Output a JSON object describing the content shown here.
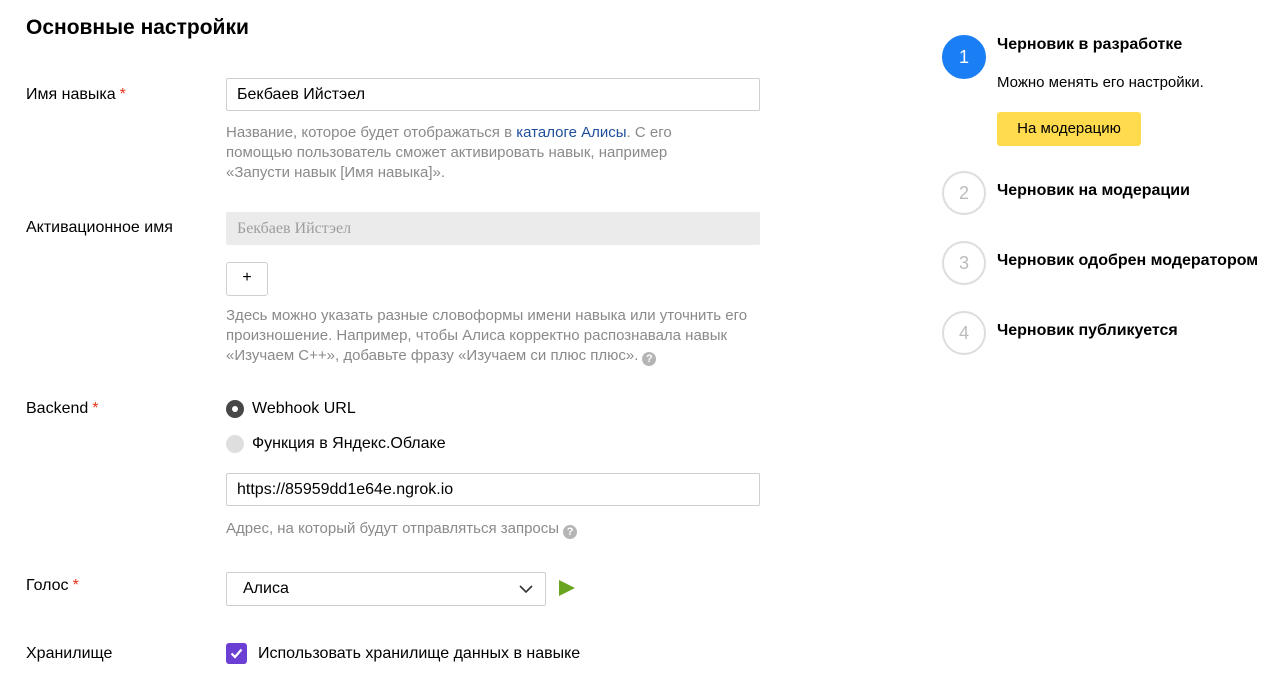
{
  "page": {
    "title": "Основные настройки"
  },
  "skill_name": {
    "label": "Имя навыка",
    "required_mark": "*",
    "value": "Бекбаев Ийстэел",
    "hint_before": "Название, которое будет отображаться в ",
    "hint_link": "каталоге Алисы",
    "hint_after": ". С его помощью пользователь сможет активировать навык, например «Запусти навык [Имя навыка]»."
  },
  "activation_name": {
    "label": "Активационное имя",
    "value": "Бекбаев Ийстэел",
    "add_button": "+",
    "hint": "Здесь можно указать разные словоформы имени навыка или уточнить его произношение. Например, чтобы Алиса корректно распознавала навык «Изучаем С++», добавьте фразу «Изучаем си плюс плюс».",
    "help_icon": "?"
  },
  "backend": {
    "label": "Backend",
    "required_mark": "*",
    "options": [
      {
        "label": "Webhook URL",
        "selected": true
      },
      {
        "label": "Функция в Яндекс.Облаке",
        "selected": false
      }
    ],
    "url_value": "https://85959dd1e64e.ngrok.io",
    "hint": "Адрес, на который будут отправляться запросы",
    "help_icon": "?"
  },
  "voice": {
    "label": "Голос",
    "required_mark": "*",
    "selected": "Алиса",
    "play_color": "#6aa51f"
  },
  "storage": {
    "label": "Хранилище",
    "checkbox_label": "Использовать хранилище данных в навыке",
    "checked": true,
    "checkbox_color": "#6b3fd4"
  },
  "steps": [
    {
      "number": "1",
      "title": "Черновик в разработке",
      "active": true
    },
    {
      "number": "2",
      "title": "Черновик на модерации",
      "active": false
    },
    {
      "number": "3",
      "title": "Черновик одобрен модератором",
      "active": false
    },
    {
      "number": "4",
      "title": "Черновик публикуется",
      "active": false
    }
  ],
  "current_step": {
    "description": "Можно менять его настройки.",
    "button_label": "На модерацию",
    "button_color": "#ffdb4d"
  },
  "colors": {
    "accent": "#1a7ff5",
    "required": "#e5331a",
    "link": "#1f4e9c"
  }
}
